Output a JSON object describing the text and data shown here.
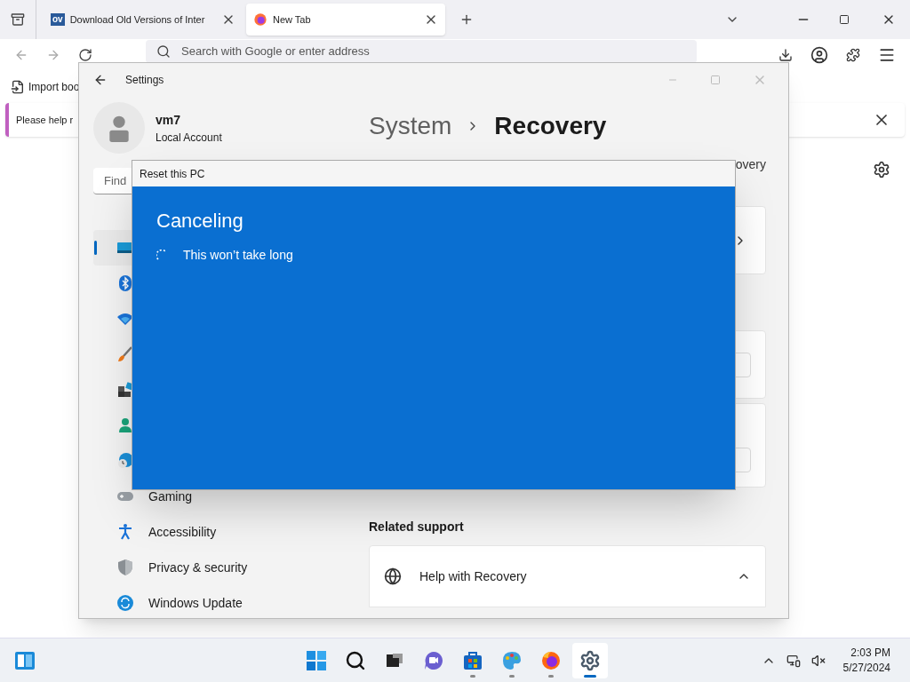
{
  "browser": {
    "tabs": [
      {
        "favicon": "ov",
        "title": "Download Old Versions of Inter",
        "selected": false
      },
      {
        "title": "New Tab",
        "selected": true
      }
    ],
    "address_placeholder": "Search with Google or enter address",
    "bookmark": "Import boo",
    "notification": "Please help r"
  },
  "settings": {
    "title": "Settings",
    "user": {
      "name": "vm7",
      "type": "Local Account"
    },
    "search_placeholder": "Find",
    "nav": [
      {
        "selected": true
      },
      {
        "selected": false
      },
      {
        "selected": false
      },
      {
        "selected": false
      },
      {
        "selected": false
      },
      {
        "selected": false
      },
      {
        "selected": false
      },
      {
        "label": "Gaming",
        "selected": false
      },
      {
        "label": "Accessibility",
        "selected": false
      },
      {
        "label": "Privacy & security",
        "selected": false
      },
      {
        "label": "Windows Update",
        "selected": false
      }
    ],
    "breadcrumb": [
      "System",
      "Recovery"
    ],
    "partial_text": "overy",
    "related_heading": "Related support",
    "help": {
      "label": "Help with Recovery",
      "expanded": true
    }
  },
  "dialog": {
    "title": "Reset this PC",
    "heading": "Canceling",
    "status": "This won’t take long"
  },
  "taskbar": {
    "apps": [
      {
        "running": false,
        "selected": false
      },
      {
        "running": false,
        "selected": false
      },
      {
        "running": false,
        "selected": false
      },
      {
        "running": false,
        "selected": false
      },
      {
        "running": true,
        "selected": false
      },
      {
        "running": true,
        "selected": false
      },
      {
        "running": true,
        "selected": false
      },
      {
        "running": true,
        "selected": true
      }
    ],
    "time": "2:03 PM",
    "date": "5/27/2024"
  }
}
